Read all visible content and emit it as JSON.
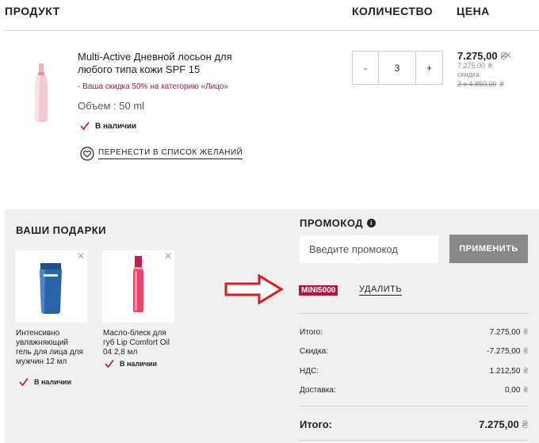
{
  "header": {
    "product": "ПРОДУКТ",
    "quantity": "КОЛИЧЕСТВО",
    "price": "ЦЕНА"
  },
  "product": {
    "name": "Multi-Active Дневной лосьон для любого типа кожи SPF 15",
    "discount_note": "- Ваша скидка 50% на категорию «Лицо»",
    "volume": "Объем : 50 ml",
    "stock": "В наличии",
    "wishlist": "ПЕРЕНЕСТИ В СПИСОК ЖЕЛАНИЙ",
    "quantity": "3",
    "qty_minus": "-",
    "qty_plus": "+",
    "price": "7.275,00",
    "price_sub": "7.275,00",
    "price_label": "скидка",
    "price_old": "3 x 4.850,00",
    "currency": "₴"
  },
  "gifts": {
    "title": "ВАШИ ПОДАРКИ",
    "items": [
      {
        "name": "Интенсивно увлажняющий гель для лица для мужчин 12 мл",
        "stock": "В наличии"
      },
      {
        "name": "Масло-блеск для губ Lip Comfort Oil 04 2,8 мл",
        "stock": "В наличии"
      }
    ]
  },
  "promo": {
    "title": "ПРОМОКОД",
    "placeholder": "Введите промокод",
    "apply": "ПРИМЕНИТЬ",
    "code": "MINI5000",
    "remove": "УДАЛИТЬ"
  },
  "summary": {
    "rows": [
      {
        "label": "Итого:",
        "value": "7.275,00"
      },
      {
        "label": "Скидка:",
        "value": "-7.275,00"
      },
      {
        "label": "НДС:",
        "value": "1.212,50"
      },
      {
        "label": "Доставка:",
        "value": "0,00"
      }
    ],
    "total_label": "Итого:",
    "total_value": "7.275,00"
  },
  "colors": {
    "accent": "#b1143c",
    "arrow": "#e0191b",
    "panel": "#f0f0f0",
    "button": "#888888"
  },
  "icons": [
    "check-icon",
    "heart-icon",
    "close-icon",
    "info-icon",
    "arrow-right-icon"
  ]
}
